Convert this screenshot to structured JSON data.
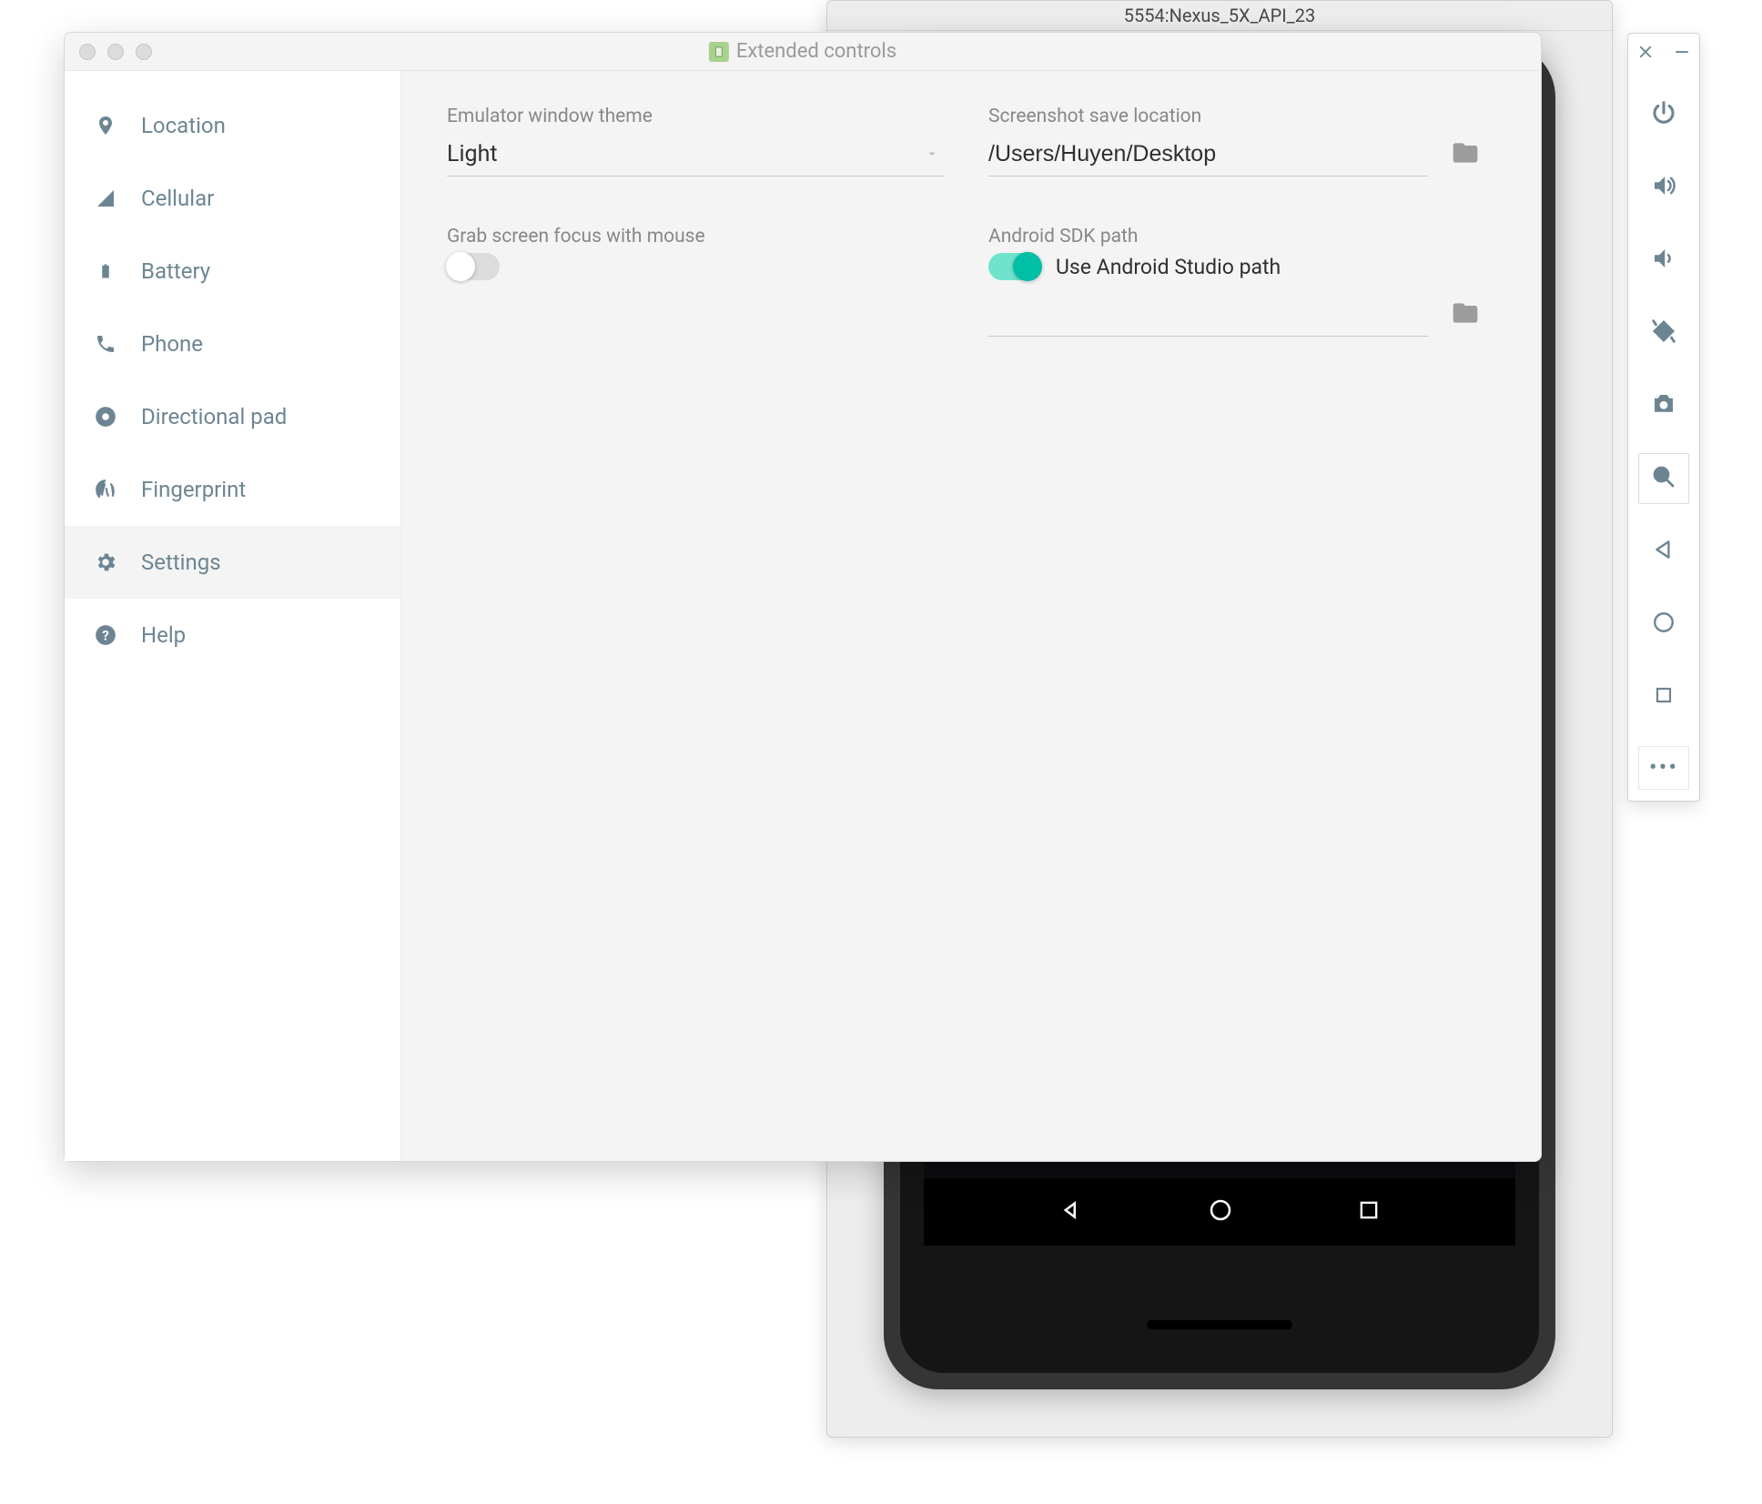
{
  "emulator": {
    "title": "5554:Nexus_5X_API_23"
  },
  "dialog": {
    "title": "Extended controls",
    "sidebar": {
      "items": [
        {
          "id": "location",
          "label": "Location"
        },
        {
          "id": "cellular",
          "label": "Cellular"
        },
        {
          "id": "battery",
          "label": "Battery"
        },
        {
          "id": "phone",
          "label": "Phone"
        },
        {
          "id": "dpad",
          "label": "Directional pad"
        },
        {
          "id": "fingerprint",
          "label": "Fingerprint"
        },
        {
          "id": "settings",
          "label": "Settings"
        },
        {
          "id": "help",
          "label": "Help"
        }
      ],
      "selected": "settings"
    },
    "settings": {
      "theme_label": "Emulator window theme",
      "theme_value": "Light",
      "grab_focus_label": "Grab screen focus with mouse",
      "grab_focus_on": false,
      "screenshot_label": "Screenshot save location",
      "screenshot_path": "/Users/Huyen/Desktop",
      "sdk_label": "Android SDK path",
      "sdk_use_studio_label": "Use Android Studio path",
      "sdk_use_studio_on": true,
      "sdk_path": ""
    }
  },
  "side_panel": {
    "tools": [
      "power",
      "volume-up",
      "volume-down",
      "rotate",
      "screenshot",
      "zoom",
      "back",
      "home",
      "overview"
    ]
  },
  "colors": {
    "accent": "#00bfa5",
    "sidebar_text": "#6d8593"
  }
}
